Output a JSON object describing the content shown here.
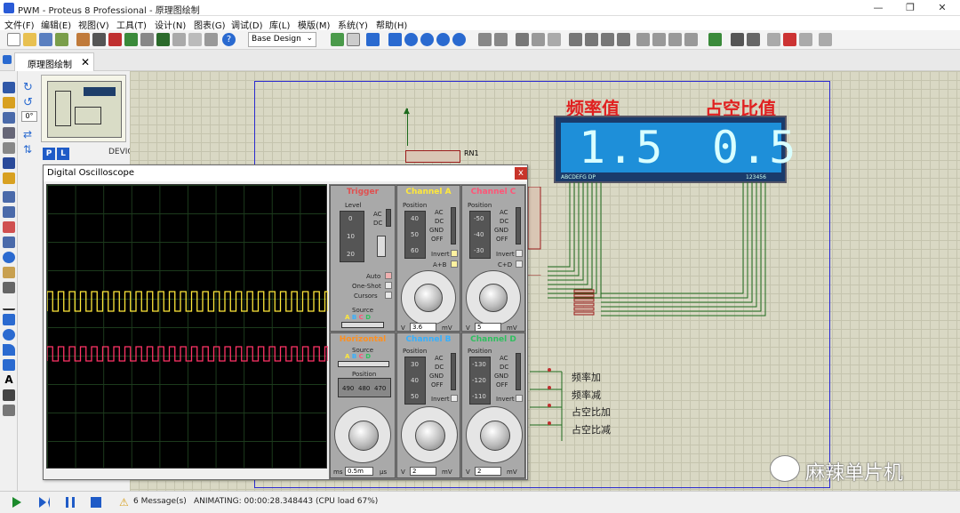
{
  "window": {
    "title": "PWM - Proteus 8 Professional - 原理图绘制",
    "minimize": "—",
    "restore": "❐",
    "close": "✕"
  },
  "menu": [
    "文件(F)",
    "编辑(E)",
    "视图(V)",
    "工具(T)",
    "设计(N)",
    "图表(G)",
    "调试(D)",
    "库(L)",
    "模版(M)",
    "系统(Y)",
    "帮助(H)"
  ],
  "toolbar": {
    "design_select": "Base Design"
  },
  "tab": {
    "label": "原理图绘制",
    "close": "✕"
  },
  "rotation": {
    "angle": "0°"
  },
  "devices": {
    "p": "P",
    "l": "L",
    "label": "DEVICES"
  },
  "schematic": {
    "freq_label": "频率值",
    "duty_label": "占空比值",
    "lcd_left": "1.5",
    "lcd_right": "0.5",
    "lcd_pins_left": "ABCDEFG DP",
    "lcd_pins_right": "123456",
    "rn1": "RN1",
    "buttons": [
      "频率加",
      "频率减",
      "占空比加",
      "占空比减"
    ]
  },
  "oscilloscope": {
    "title": "Digital Oscilloscope",
    "close": "x",
    "trigger": {
      "title": "Trigger",
      "level": "Level",
      "level_ticks": [
        "0",
        "10",
        "20"
      ],
      "ac": "AC",
      "dc": "DC",
      "auto": "Auto",
      "oneshot": "One-Shot",
      "cursors": "Cursors",
      "source": "Source",
      "source_letters": [
        "A",
        "B",
        "C",
        "D"
      ]
    },
    "channel_a": {
      "title": "Channel A",
      "position": "Position",
      "ticks": [
        "40",
        "50",
        "60"
      ],
      "modes": [
        "AC",
        "DC",
        "GND",
        "OFF"
      ],
      "invert": "Invert",
      "aplusb": "A+B",
      "volts": "3.6",
      "unit_v": "V",
      "unit_mv": "mV"
    },
    "channel_c": {
      "title": "Channel C",
      "position": "Position",
      "ticks": [
        "-50",
        "-40",
        "-30"
      ],
      "modes": [
        "AC",
        "DC",
        "GND",
        "OFF"
      ],
      "invert": "Invert",
      "cplusd": "C+D",
      "volts": "5",
      "unit_v": "V",
      "unit_mv": "mV"
    },
    "horizontal": {
      "title": "Horizontal",
      "source": "Source",
      "source_letters": [
        "A",
        "B",
        "C",
        "D"
      ],
      "position": "Position",
      "ticks": [
        "490",
        "480",
        "470"
      ],
      "time": "0.5m",
      "unit_ms": "ms",
      "unit_us": "µs"
    },
    "channel_b": {
      "title": "Channel B",
      "position": "Position",
      "ticks": [
        "30",
        "40",
        "50"
      ],
      "modes": [
        "AC",
        "DC",
        "GND",
        "OFF"
      ],
      "invert": "Invert",
      "volts": "2",
      "unit_v": "V",
      "unit_mv": "mV"
    },
    "channel_d": {
      "title": "Channel D",
      "position": "Position",
      "ticks": [
        "-130",
        "-120",
        "-110"
      ],
      "modes": [
        "AC",
        "DC",
        "GND",
        "OFF"
      ],
      "invert": "Invert",
      "volts": "2",
      "unit_v": "V",
      "unit_mv": "mV"
    },
    "colors": {
      "trigger": "#e05050",
      "a": "#ffe83a",
      "b": "#35b0ff",
      "c": "#ff5577",
      "d": "#2fbf5f",
      "horizontal": "#ff9020"
    }
  },
  "status": {
    "messages": "6 Message(s)",
    "animating": "ANIMATING: 00:00:28.348443 (CPU load 67%)"
  },
  "watermark": {
    "text": "麻辣单片机"
  }
}
